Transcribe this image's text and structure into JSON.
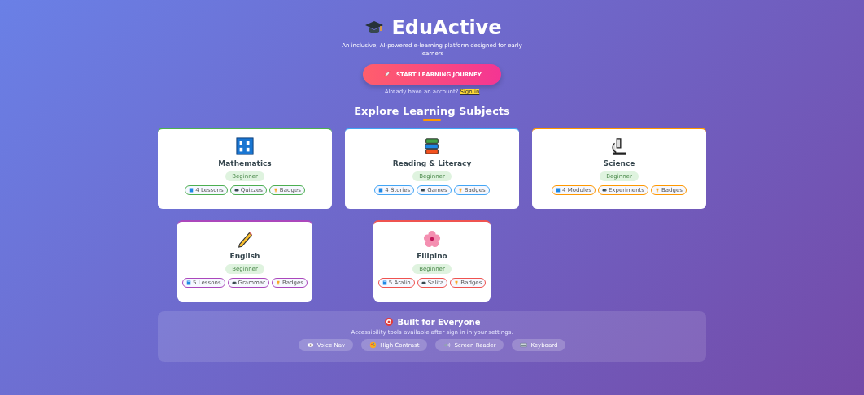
{
  "header": {
    "title": "EduActive",
    "tagline": "An inclusive, AI-powered e-learning platform designed for early learners",
    "cta": "START LEARNING JOURNEY",
    "signin_prompt": "Already have an account?",
    "signin_link": "Sign in"
  },
  "subjects_heading": "Explore Learning Subjects",
  "subjects": [
    {
      "kind": "numbers",
      "name": "Mathematics",
      "level": "Beginner",
      "color": "#4caf50",
      "chips": [
        "4 Lessons",
        "Quizzes",
        "Badges"
      ]
    },
    {
      "kind": "books",
      "name": "Reading & Literacy",
      "level": "Beginner",
      "color": "#42a5f5",
      "chips": [
        "4 Stories",
        "Games",
        "Badges"
      ]
    },
    {
      "kind": "microscope",
      "name": "Science",
      "level": "Beginner",
      "color": "#ff9800",
      "chips": [
        "4 Modules",
        "Experiments",
        "Badges"
      ]
    },
    {
      "kind": "pencil",
      "name": "English",
      "level": "Beginner",
      "color": "#ab47bc",
      "chips": [
        "5 Lessons",
        "Grammar",
        "Badges"
      ]
    },
    {
      "kind": "flower",
      "name": "Filipino",
      "level": "Beginner",
      "color": "#ef5350",
      "chips": [
        "5 Aralin",
        "Salita",
        "Badges"
      ]
    }
  ],
  "accessibility": {
    "title": "Built for Everyone",
    "note": "Accessibility tools available after sign in in your settings.",
    "buttons": [
      {
        "kind": "eye",
        "label": "Voice Nav"
      },
      {
        "kind": "palette",
        "label": "High Contrast"
      },
      {
        "kind": "speaker",
        "label": "Screen Reader"
      },
      {
        "kind": "keyboard",
        "label": "Keyboard"
      }
    ]
  }
}
